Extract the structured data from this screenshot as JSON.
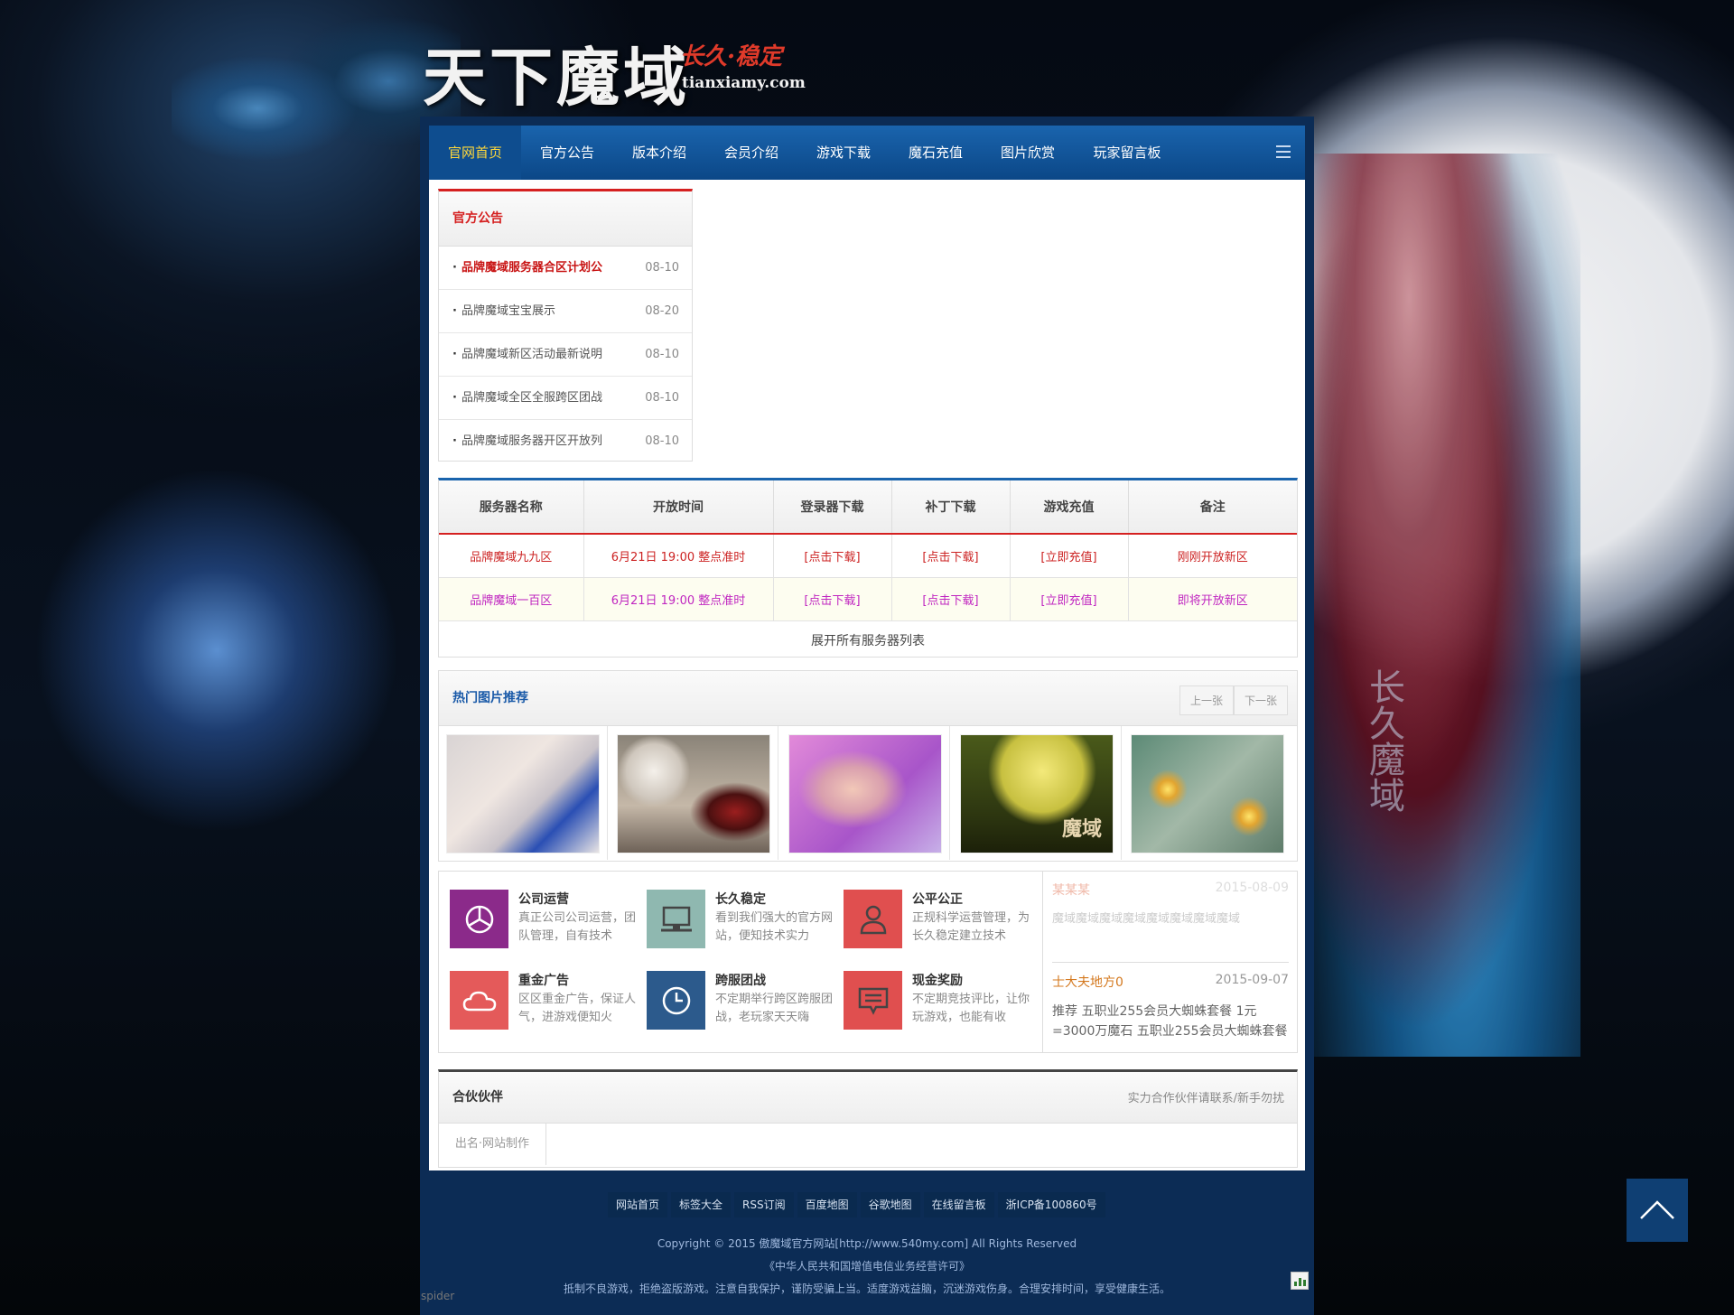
{
  "header": {
    "logo_text": "天下魔域",
    "logo_slogan": "长久·稳定",
    "logo_domain": "tianxiamy.com"
  },
  "nav": {
    "items": [
      {
        "label": "官网首页",
        "active": true
      },
      {
        "label": "官方公告"
      },
      {
        "label": "版本介绍"
      },
      {
        "label": "会员介绍"
      },
      {
        "label": "游戏下载"
      },
      {
        "label": "魔石充值"
      },
      {
        "label": "图片欣赏"
      },
      {
        "label": "玩家留言板"
      }
    ],
    "menu_icon": "menu-icon"
  },
  "notice": {
    "title": "官方公告",
    "items": [
      {
        "title": "品牌魔域服务器合区计划公",
        "date": "08-10",
        "hot": true
      },
      {
        "title": "品牌魔域宝宝展示",
        "date": "08-20"
      },
      {
        "title": "品牌魔域新区活动最新说明",
        "date": "08-10"
      },
      {
        "title": "品牌魔域全区全服跨区团战",
        "date": "08-10"
      },
      {
        "title": "品牌魔域服务器开区开放列",
        "date": "08-10"
      }
    ]
  },
  "servers": {
    "headers": [
      "服务器名称",
      "开放时间",
      "登录器下载",
      "补丁下载",
      "游戏充值",
      "备注"
    ],
    "rows": [
      [
        "品牌魔域九九区",
        "6月21日 19:00 整点准时",
        "[点击下载]",
        "[点击下载]",
        "[立即充值]",
        "刚刚开放新区"
      ],
      [
        "品牌魔域一百区",
        "6月21日 19:00 整点准时",
        "[点击下载]",
        "[点击下载]",
        "[立即充值]",
        "即将开放新区"
      ]
    ],
    "expand_label": "展开所有服务器列表"
  },
  "pictures": {
    "title": "热门图片推荐",
    "prev_label": "上一张",
    "next_label": "下一张",
    "overlay_text": "魔域"
  },
  "features": [
    {
      "title": "公司运营",
      "desc": "真正公司公司运营，团队管理，自有技术",
      "color": "#8b2a8a",
      "icon": "pie-icon"
    },
    {
      "title": "长久稳定",
      "desc": "看到我们强大的官方网站，便知技术实力",
      "color": "#8fb8b0",
      "icon": "monitor-icon"
    },
    {
      "title": "公平公正",
      "desc": "正规科学运营管理，为长久稳定建立技术",
      "color": "#e04f4f",
      "icon": "user-icon"
    },
    {
      "title": "重金广告",
      "desc": "区区重金广告，保证人气，进游戏便知火",
      "color": "#e45a5a",
      "icon": "cloud-icon"
    },
    {
      "title": "跨服团战",
      "desc": "不定期举行跨区跨服团战，老玩家天天嗨",
      "color": "#2c5a8c",
      "icon": "clock-icon"
    },
    {
      "title": "现金奖励",
      "desc": "不定期竞技评比，让你玩游戏，也能有收",
      "color": "#e04f4f",
      "icon": "chat-icon"
    }
  ],
  "news": [
    {
      "name": "某某某",
      "date": "2015-08-09",
      "text": "魔域魔域魔域魔域魔域魔域魔域魔域",
      "faded": true
    },
    {
      "name": "士大夫地方0",
      "date": "2015-09-07",
      "text": "推荐 五职业255会员大蜘蛛套餐 1元=3000万魔石 五职业255会员大蜘蛛套餐"
    }
  ],
  "partners": {
    "title": "合伙伙伴",
    "note": "实力合作伙伴请联系/新手勿扰",
    "links": [
      "出名·网站制作"
    ]
  },
  "footer": {
    "links": [
      "网站首页",
      "标签大全",
      "RSS订阅",
      "百度地图",
      "谷歌地图",
      "在线留言板",
      "浙ICP备100860号"
    ],
    "copyright": "Copyright © 2015 傲魔域官方网站[http://www.540my.com] All Rights Reserved",
    "license": "《中华人民共和国增值电信业务经营许可》",
    "advice": "抵制不良游戏，拒绝盗版游戏。注意自我保护，谨防受骗上当。适度游戏益脑，沉迷游戏伤身。合理安排时间，享受健康生活。"
  },
  "misc": {
    "back_to_top_icon": "arrow-up-icon",
    "spider_alt": "spider",
    "side_text": "长久魔域"
  },
  "colors": {
    "nav_bg": "#1a64ad",
    "nav_active": "#ffd83a",
    "accent_red": "#d52020",
    "server_row2": "#c026c0"
  }
}
